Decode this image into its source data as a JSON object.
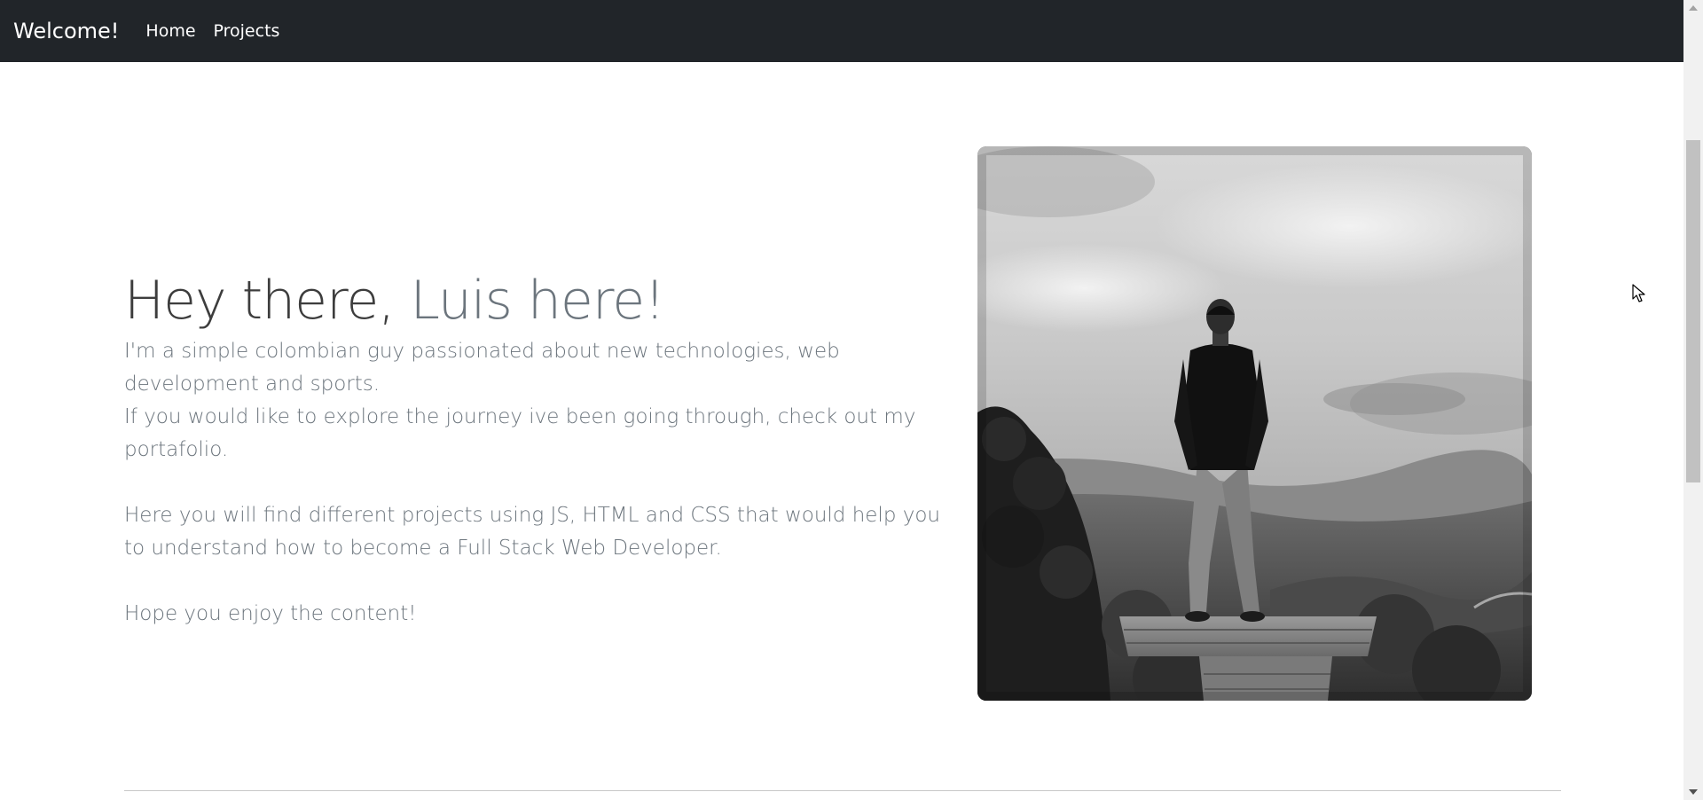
{
  "navbar": {
    "brand": "Welcome!",
    "links": [
      {
        "label": "Home"
      },
      {
        "label": "Projects"
      }
    ],
    "background": "#212529"
  },
  "hero": {
    "title_part1": "Hey there, ",
    "title_part2": "Luis here!",
    "paragraphs": [
      "I'm a simple colombian guy passionated about new technologies, web development and sports.",
      "If you would like to explore the journey ive been going through, check out my portafolio.",
      "Here you will find different projects using JS, HTML and CSS that would help you to understand how to become a Full Stack Web Developer.",
      "Hope you enjoy the content!"
    ]
  },
  "photo": {
    "icon": "profile-photo"
  },
  "colors": {
    "text_muted": "#6c757d",
    "title_dark": "#3d3d3d",
    "navbar_bg": "#212529"
  }
}
